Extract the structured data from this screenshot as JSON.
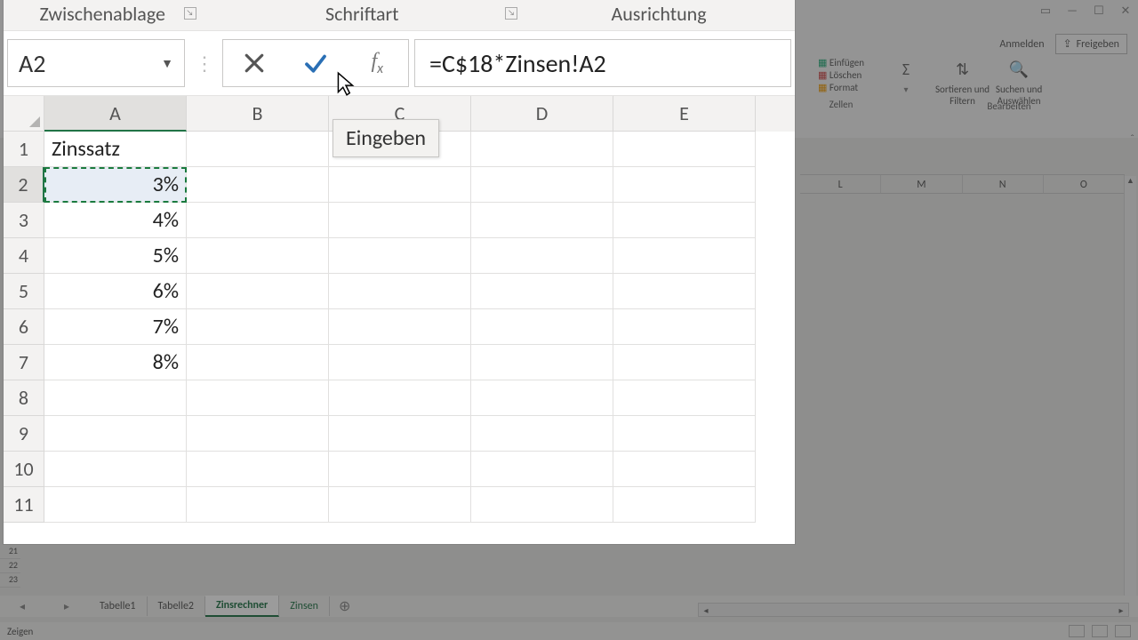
{
  "ribbon_groups": {
    "clipboard": "Zwischenablage",
    "font": "Schriftart",
    "alignment": "Ausrichtung"
  },
  "namebox": {
    "value": "A2"
  },
  "formula_bar": {
    "cancel_tooltip": "Abbrechen",
    "enter_tooltip": "Eingeben",
    "fx_tooltip": "Funktion einfügen",
    "value": "=C$18*Zinsen!A2"
  },
  "tooltip_text": "Eingeben",
  "columns": [
    "A",
    "B",
    "C",
    "D",
    "E"
  ],
  "rows": [
    {
      "n": "1",
      "A": "Zinssatz"
    },
    {
      "n": "2",
      "A": "3%"
    },
    {
      "n": "3",
      "A": "4%"
    },
    {
      "n": "4",
      "A": "5%"
    },
    {
      "n": "5",
      "A": "6%"
    },
    {
      "n": "6",
      "A": "7%"
    },
    {
      "n": "7",
      "A": "8%"
    },
    {
      "n": "8",
      "A": ""
    },
    {
      "n": "9",
      "A": ""
    },
    {
      "n": "10",
      "A": ""
    },
    {
      "n": "11",
      "A": ""
    }
  ],
  "selected_cell": "A2",
  "bg": {
    "account": "Anmelden",
    "share": "Freigeben",
    "tools": {
      "insert": "Einfügen",
      "delete": "Löschen",
      "format": "Format",
      "cells_group": "Zellen",
      "sort": "Sortieren und\nFiltern",
      "find": "Suchen und\nAuswählen",
      "edit_group": "Bearbeiten"
    },
    "cols": [
      "L",
      "M",
      "N",
      "O"
    ],
    "rows": [
      "21",
      "22",
      "23"
    ],
    "tabs": [
      "Tabelle1",
      "Tabelle2",
      "Zinsrechner",
      "Zinsen"
    ],
    "active_tab": 2,
    "status": "Zeigen"
  }
}
